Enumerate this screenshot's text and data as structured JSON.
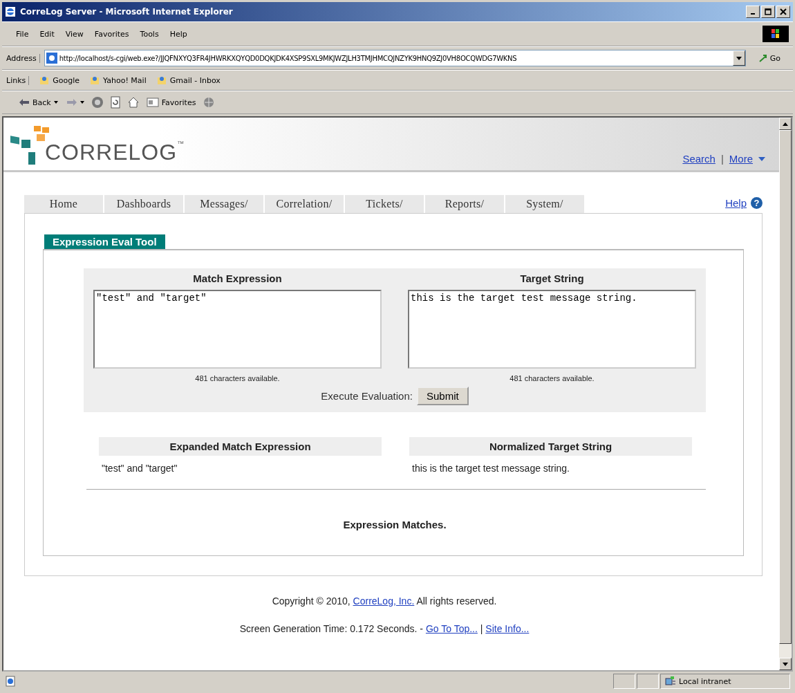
{
  "window": {
    "title": "CorreLog Server - Microsoft Internet Explorer"
  },
  "menu_bar": {
    "items": [
      "File",
      "Edit",
      "View",
      "Favorites",
      "Tools",
      "Help"
    ]
  },
  "address_bar": {
    "label": "Address",
    "url": "http://localhost/s-cgi/web.exe?/JJQFNXYQ3FR4JHWRKXQYQD0DQKJDK4XSP9SXL9MKJWZJLH3TMJHMCQJNZYK9HNQ9ZJ0VH8OCQWDG7WKNS",
    "go": "Go"
  },
  "links_bar": {
    "label": "Links",
    "links": [
      "Google",
      "Yahoo! Mail",
      "Gmail - Inbox"
    ]
  },
  "toolbar": {
    "back": "Back",
    "favorites": "Favorites"
  },
  "header": {
    "logo": "CORRELOG",
    "trademark": "™",
    "links": [
      "Search",
      "More"
    ],
    "separator": "|"
  },
  "nav": {
    "tabs": [
      {
        "label": "Home",
        "selected": false
      },
      {
        "label": "Dashboards",
        "selected": false
      },
      {
        "label": "Messages/",
        "selected": false
      },
      {
        "label": "Correlation/",
        "selected": false
      },
      {
        "label": "Tickets/",
        "selected": false
      },
      {
        "label": "Reports/",
        "selected": false
      },
      {
        "label": "System/",
        "selected": false
      }
    ],
    "help": "Help",
    "help_icon": "?"
  },
  "tool_title": "Expression Eval Tool",
  "form": {
    "fields": [
      {
        "label": "Match Expression",
        "value": "\"test\" and \"target\"",
        "counter": "481 characters available."
      },
      {
        "label": "Target String",
        "value": "this is the target test message string.",
        "counter": "481 characters available."
      }
    ],
    "execute_label": "Execute Evaluation:",
    "submit": "Submit"
  },
  "results": [
    {
      "heading": "Expanded Match Expression",
      "value": "\"test\" and \"target\""
    },
    {
      "heading": "Normalized Target String",
      "value": "this is the target test message string."
    }
  ],
  "result_message": "Expression Matches.",
  "footer": {
    "copyright": "Copyright © 2010,",
    "company": "CorreLog, Inc.",
    "rights": "All rights reserved.",
    "generation": "Screen Generation Time: 0.172 Seconds. -",
    "links": [
      "Go To Top...",
      "Site Info..."
    ],
    "separator": "|"
  },
  "status_bar": {
    "zone": "Local intranet"
  }
}
